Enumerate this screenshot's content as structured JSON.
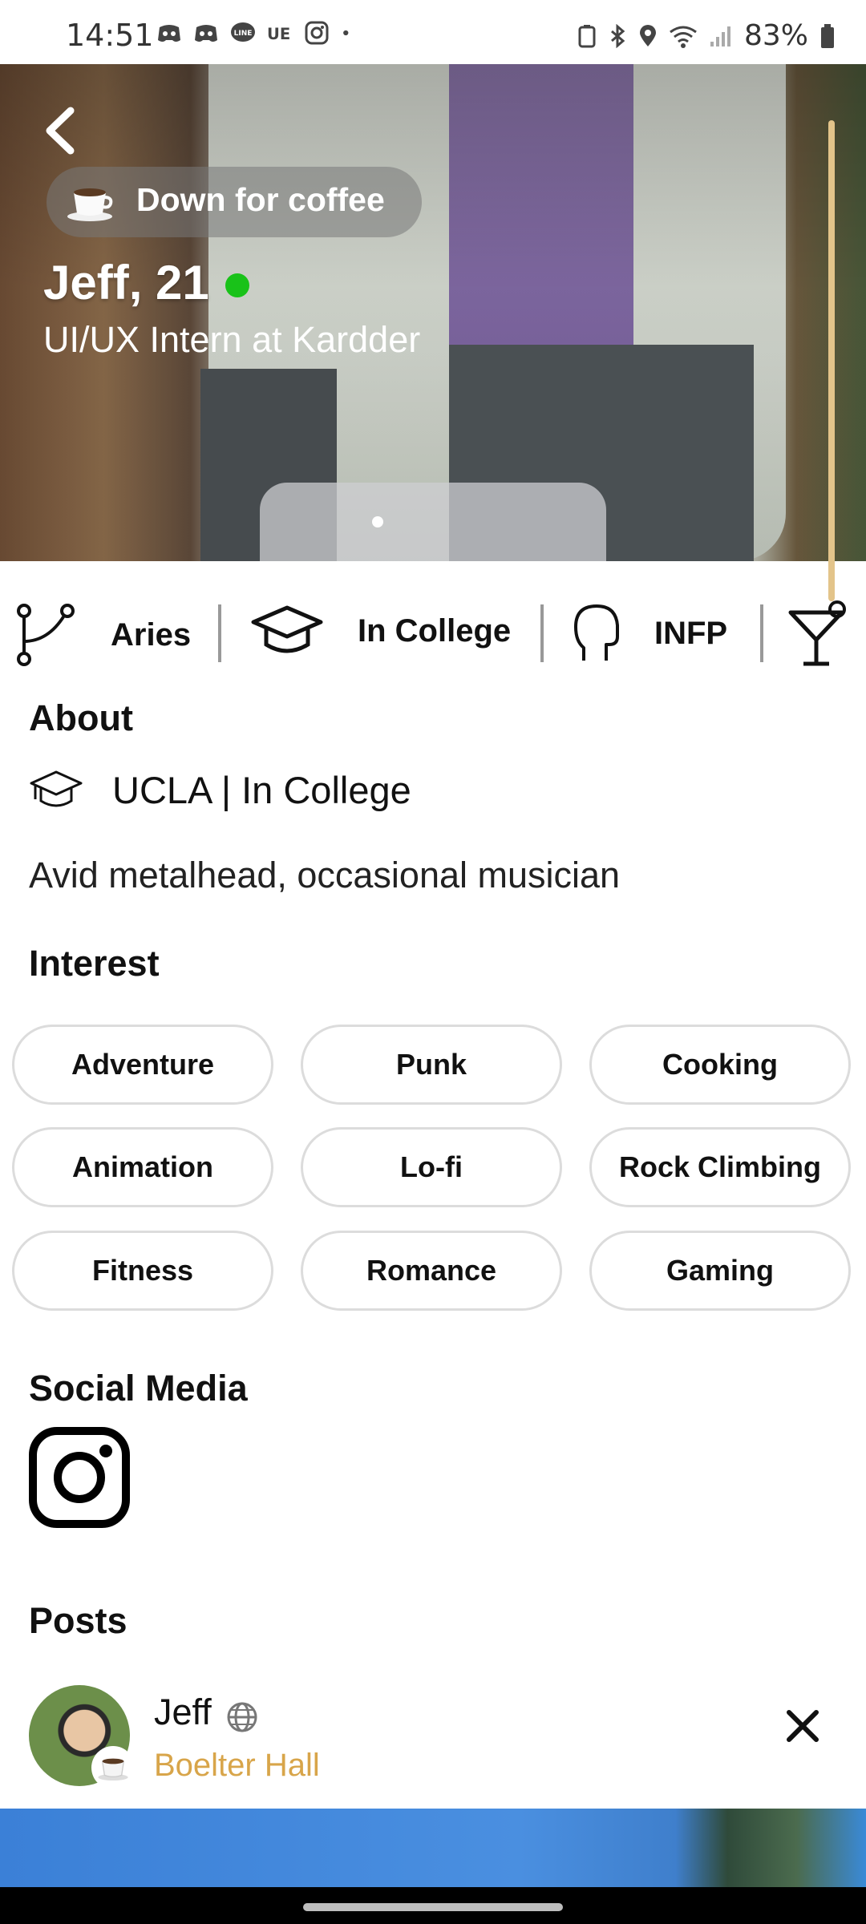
{
  "status_bar": {
    "time": "14:51",
    "notification_icons": [
      "discord-icon",
      "discord-icon",
      "line-icon",
      "uber-eats-icon",
      "instagram-icon",
      "dot-icon"
    ],
    "system_icons": [
      "battery-saver-icon",
      "bluetooth-icon",
      "location-icon",
      "wifi-icon",
      "signal-icon",
      "battery-icon"
    ],
    "battery": "83%"
  },
  "profile": {
    "status_pill": "Down for coffee",
    "status_icon": "coffee-icon",
    "name_age": "Jeff, 21",
    "online": true,
    "online_color": "#19c219",
    "job": "UI/UX Intern at Kardder"
  },
  "attributes": [
    {
      "icon": "zodiac-icon",
      "label": "Aries"
    },
    {
      "icon": "graduation-cap-icon",
      "label": "In College"
    },
    {
      "icon": "head-icon",
      "label": "INFP"
    },
    {
      "icon": "cocktail-icon",
      "label": ""
    }
  ],
  "about": {
    "title": "About",
    "education": "UCLA | In College",
    "bio": "Avid metalhead, occasional musician"
  },
  "interest": {
    "title": "Interest",
    "chips": [
      "Adventure",
      "Punk",
      "Cooking",
      "Animation",
      "Lo-fi",
      "Rock Climbing",
      "Fitness",
      "Romance",
      "Gaming"
    ]
  },
  "social_media": {
    "title": "Social Media",
    "links": [
      "instagram-icon"
    ]
  },
  "posts": {
    "title": "Posts",
    "author": "Jeff",
    "location": "Boelter Hall",
    "location_color": "#d8a54a"
  }
}
